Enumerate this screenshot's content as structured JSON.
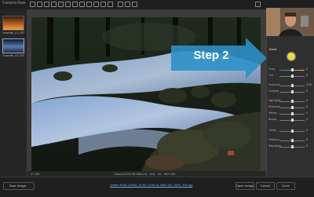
{
  "window": {
    "title": "Camera Raw"
  },
  "filmstrip": {
    "items": [
      {
        "label": "Yosemite_01.CR2"
      },
      {
        "label": "Yosemite_02.CR2"
      }
    ]
  },
  "overlay": {
    "step_label": "Step 2"
  },
  "status": {
    "zoom": "17.4%",
    "info": "Canon EOS 5D Mark III · f/16 · 2s · ISO 100",
    "link_text": "Adobe RGB (1998); 16 bit; 5760 by 3840 (22.1MP); 300 ppi"
  },
  "bottom": {
    "save_label": "Save Image...",
    "open_label": "Open Image",
    "cancel_label": "Cancel",
    "done_label": "Done"
  },
  "panel": {
    "header": "Basic",
    "sliders": [
      {
        "name": "Temp",
        "value": "0"
      },
      {
        "name": "Tint",
        "value": "0"
      },
      {
        "name": "Exposure",
        "value": "0.00"
      },
      {
        "name": "Contrast",
        "value": "0"
      },
      {
        "name": "Highlights",
        "value": "0"
      },
      {
        "name": "Shadows",
        "value": "0"
      },
      {
        "name": "Whites",
        "value": "0"
      },
      {
        "name": "Blacks",
        "value": "0"
      },
      {
        "name": "Clarity",
        "value": "0"
      },
      {
        "name": "Vibrance",
        "value": "0"
      },
      {
        "name": "Saturation",
        "value": "0"
      }
    ]
  },
  "colors": {
    "accent": "#2f90c8",
    "highlight": "#e7d84a"
  }
}
